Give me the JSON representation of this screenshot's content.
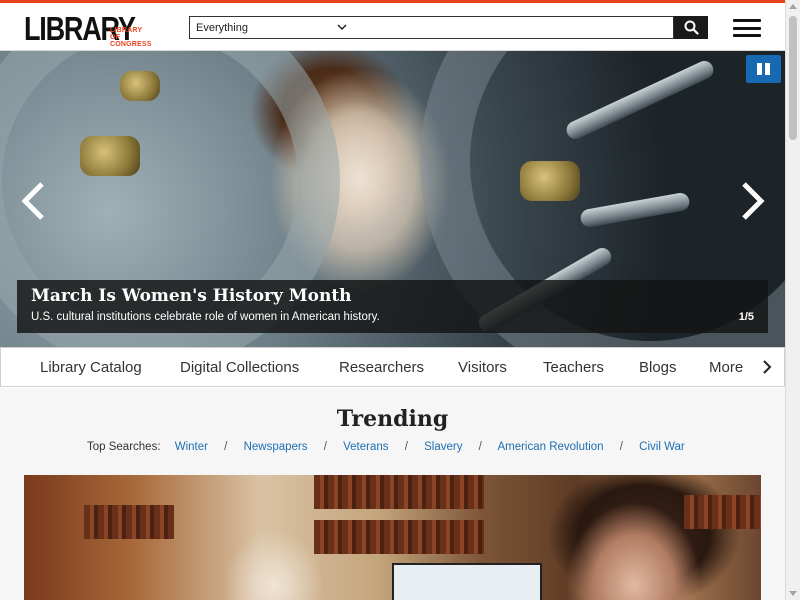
{
  "colors": {
    "accent": "#e8431f",
    "link": "#1f6fb2",
    "pause_button": "#1769b1"
  },
  "header": {
    "logo_main": "LIBRARY",
    "logo_sub_line1": "LIBRARY",
    "logo_sub_line2": "OF CONGRESS",
    "search_scope": "Everything",
    "search_placeholder": "",
    "search_icon": "search-icon",
    "menu_icon": "hamburger-menu-icon"
  },
  "hero": {
    "title": "March Is Women's History Month",
    "description": "U.S. cultural institutions celebrate role of women in American history.",
    "slide_counter": "1/5",
    "pause_icon": "pause-icon",
    "prev_icon": "chevron-left-icon",
    "next_icon": "chevron-right-icon"
  },
  "nav": {
    "items": [
      {
        "label": "Library Catalog"
      },
      {
        "label": "Digital Collections"
      },
      {
        "label": "Researchers"
      },
      {
        "label": "Visitors"
      },
      {
        "label": "Teachers"
      },
      {
        "label": "Blogs"
      },
      {
        "label": "More"
      }
    ],
    "next_icon": "chevron-right-icon"
  },
  "trending": {
    "title": "Trending",
    "top_searches_label": "Top Searches:",
    "searches": [
      "Winter",
      "Newspapers",
      "Veterans",
      "Slavery",
      "American Revolution",
      "Civil War"
    ],
    "separator": "/"
  }
}
